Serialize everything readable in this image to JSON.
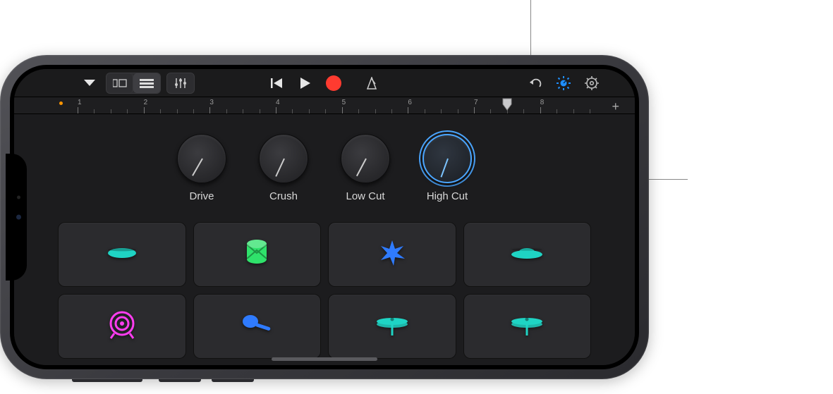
{
  "toolbar": {
    "menu_icon": "chevron-down",
    "view_grid_icon": "cells",
    "view_list_icon": "list",
    "mixer_icon": "sliders",
    "prev_icon": "previous",
    "play_icon": "play",
    "record_icon": "record",
    "metronome_icon": "metronome",
    "undo_icon": "undo",
    "fx_icon": "fx-dial",
    "settings_icon": "gear"
  },
  "ruler": {
    "bars": [
      1,
      2,
      3,
      4,
      5,
      6,
      7,
      8
    ],
    "playhead_bar": 7.5
  },
  "knobs": [
    {
      "label": "Drive",
      "active": false,
      "angle_deg": 30
    },
    {
      "label": "Crush",
      "active": false,
      "angle_deg": 25
    },
    {
      "label": "Low Cut",
      "active": false,
      "angle_deg": 28
    },
    {
      "label": "High Cut",
      "active": true,
      "angle_deg": 20
    }
  ],
  "pads": {
    "row1": [
      {
        "name": "lips",
        "color": "#1fd4c4"
      },
      {
        "name": "drum",
        "color": "#2fe26b"
      },
      {
        "name": "burst",
        "color": "#2f7bff"
      },
      {
        "name": "ufo",
        "color": "#1fd4c4"
      }
    ],
    "row2": [
      {
        "name": "gong",
        "color": "#ff3df0"
      },
      {
        "name": "maraca",
        "color": "#2f7bff"
      },
      {
        "name": "hihat",
        "color": "#1fd4c4"
      },
      {
        "name": "hihat",
        "color": "#1fd4c4"
      }
    ]
  },
  "colors": {
    "accent": "#1f8fff",
    "record": "#ff3b30"
  }
}
